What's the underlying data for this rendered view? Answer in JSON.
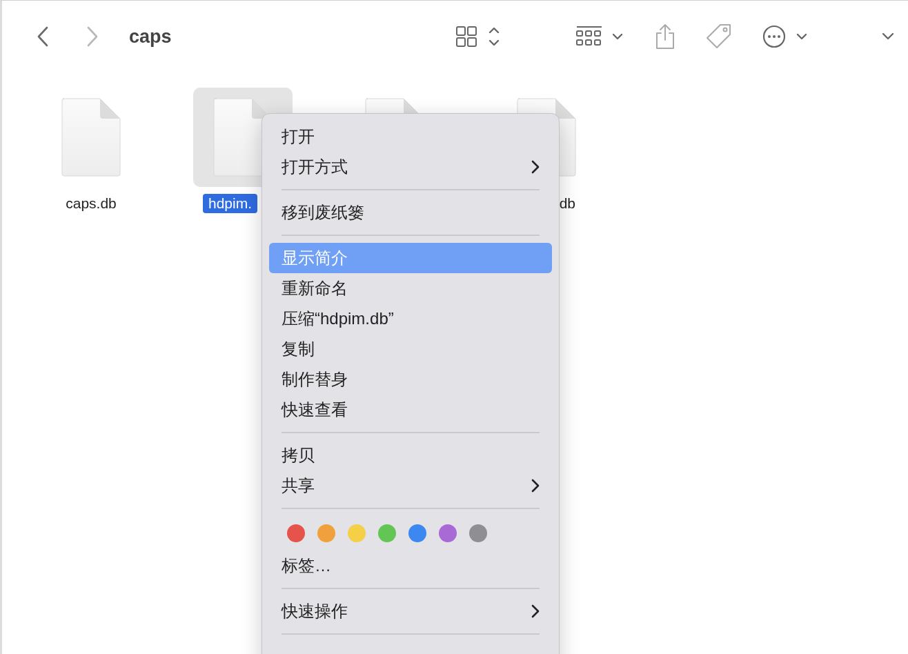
{
  "toolbar": {
    "title": "caps",
    "back_enabled": true,
    "forward_enabled": false
  },
  "files": [
    {
      "name": "caps.db",
      "selected": false
    },
    {
      "name": "hdpim.",
      "selected": true
    },
    {
      "selected": false
    },
    {
      "name": "db",
      "selected": false
    }
  ],
  "context_menu": {
    "items": [
      {
        "kind": "item",
        "label": "打开",
        "submenu": false,
        "selected": false
      },
      {
        "kind": "item",
        "label": "打开方式",
        "submenu": true,
        "selected": false
      },
      {
        "kind": "separator"
      },
      {
        "kind": "item",
        "label": "移到废纸篓",
        "submenu": false,
        "selected": false
      },
      {
        "kind": "separator"
      },
      {
        "kind": "item",
        "label": "显示简介",
        "submenu": false,
        "selected": true
      },
      {
        "kind": "item",
        "label": "重新命名",
        "submenu": false,
        "selected": false
      },
      {
        "kind": "item",
        "label": "压缩“hdpim.db”",
        "submenu": false,
        "selected": false
      },
      {
        "kind": "item",
        "label": "复制",
        "submenu": false,
        "selected": false
      },
      {
        "kind": "item",
        "label": "制作替身",
        "submenu": false,
        "selected": false
      },
      {
        "kind": "item",
        "label": "快速查看",
        "submenu": false,
        "selected": false
      },
      {
        "kind": "separator"
      },
      {
        "kind": "item",
        "label": "拷贝",
        "submenu": false,
        "selected": false
      },
      {
        "kind": "item",
        "label": "共享",
        "submenu": true,
        "selected": false
      },
      {
        "kind": "separator"
      },
      {
        "kind": "colors",
        "tags": [
          {
            "color": "#e5534b"
          },
          {
            "color": "#f0a03c"
          },
          {
            "color": "#f5cf47"
          },
          {
            "color": "#62c554"
          },
          {
            "color": "#3d87f0"
          },
          {
            "color": "#a86bd6"
          },
          {
            "color": "#8e8e93"
          }
        ]
      },
      {
        "kind": "item",
        "label": "标签…",
        "submenu": false,
        "selected": false
      },
      {
        "kind": "separator"
      },
      {
        "kind": "item",
        "label": "快速操作",
        "submenu": true,
        "selected": false
      },
      {
        "kind": "separator"
      }
    ]
  }
}
